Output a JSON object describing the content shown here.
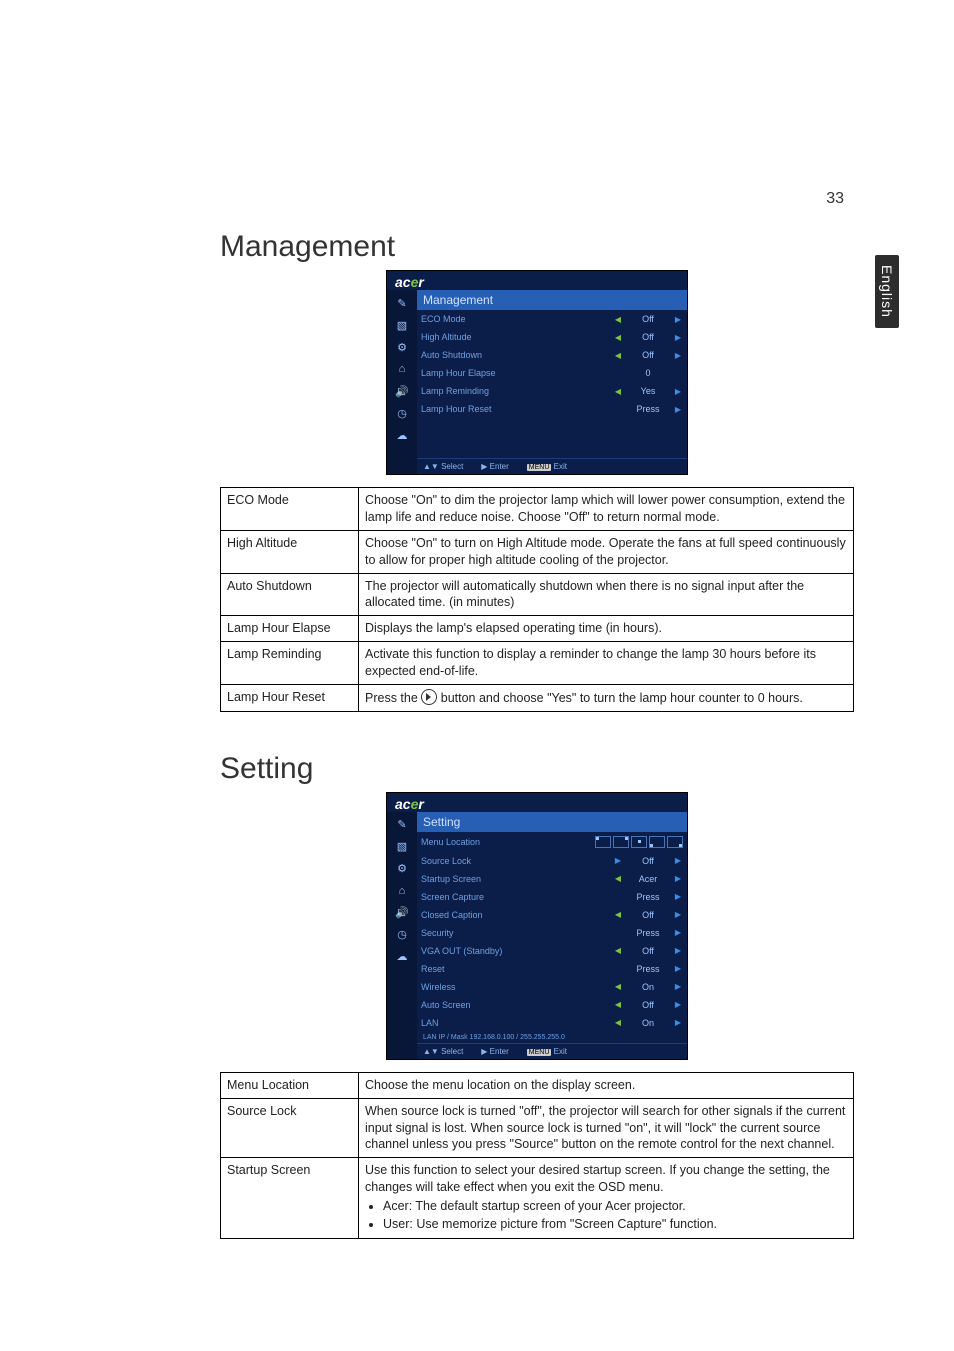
{
  "page": {
    "number": "33",
    "language": "English"
  },
  "sections": {
    "management": {
      "heading": "Management",
      "osd": {
        "brand_a": "ac",
        "brand_e": "e",
        "brand_r": "r",
        "title": "Management",
        "rows": [
          {
            "label": "ECO Mode",
            "value": "Off"
          },
          {
            "label": "High Altitude",
            "value": "Off"
          },
          {
            "label": "Auto Shutdown",
            "value": "Off"
          },
          {
            "label": "Lamp Hour Elapse",
            "value": "0"
          },
          {
            "label": "Lamp Reminding",
            "value": "Yes"
          },
          {
            "label": "Lamp Hour Reset",
            "value": "Press"
          }
        ],
        "footer": {
          "select": "Select",
          "enter": "Enter",
          "menu": "MENU",
          "exit": "Exit"
        }
      },
      "table": [
        {
          "k": "ECO Mode",
          "v": "Choose \"On\" to dim the projector lamp which will lower power consumption, extend the lamp life and reduce noise.  Choose \"Off\" to return normal mode."
        },
        {
          "k": "High Altitude",
          "v": "Choose \"On\" to turn on High Altitude mode. Operate the fans at full speed continuously to allow for proper high altitude cooling of the projector."
        },
        {
          "k": "Auto Shutdown",
          "v": "The projector will automatically shutdown when there is no signal input after the allocated time. (in minutes)"
        },
        {
          "k": "Lamp Hour Elapse",
          "v": "Displays the lamp's elapsed operating time (in hours)."
        },
        {
          "k": "Lamp Reminding",
          "v": "Activate this function to display a reminder to change the lamp 30 hours before its expected end-of-life."
        },
        {
          "k": "Lamp Hour Reset",
          "v_pre": "Press the ",
          "v_post": " button and choose \"Yes\" to turn the lamp hour counter to 0 hours."
        }
      ]
    },
    "setting": {
      "heading": "Setting",
      "osd": {
        "title": "Setting",
        "loc_label": "Menu Location",
        "rows": [
          {
            "label": "Source Lock",
            "value": "Off"
          },
          {
            "label": "Startup Screen",
            "value": "Acer"
          },
          {
            "label": "Screen Capture",
            "value": "Press"
          },
          {
            "label": "Closed Caption",
            "value": "Off"
          },
          {
            "label": "Security",
            "value": "Press"
          },
          {
            "label": "VGA OUT (Standby)",
            "value": "Off"
          },
          {
            "label": "Reset",
            "value": "Press"
          },
          {
            "label": "Wireless",
            "value": "On"
          },
          {
            "label": "Auto Screen",
            "value": "Off"
          },
          {
            "label": "LAN",
            "value": "On"
          }
        ],
        "note": "LAN IP / Mask          192.168.0.100 / 255.255.255.0",
        "footer": {
          "select": "Select",
          "enter": "Enter",
          "menu": "MENU",
          "exit": "Exit"
        }
      },
      "table": [
        {
          "k": "Menu Location",
          "v": "Choose the menu location on the display screen."
        },
        {
          "k": "Source Lock",
          "v": "When source lock is turned \"off\", the projector will search for other signals if the current input signal is lost. When source lock is turned \"on\", it will \"lock\" the current source channel unless you press \"Source\" button on the remote control for the next channel."
        },
        {
          "k": "Startup Screen",
          "v": "Use this function to select your desired startup screen. If you change the setting, the changes will take effect when you exit the OSD menu.",
          "bullets": [
            "Acer: The default startup screen of your Acer projector.",
            "User: Use memorize picture from \"Screen Capture\" function."
          ]
        }
      ]
    }
  }
}
